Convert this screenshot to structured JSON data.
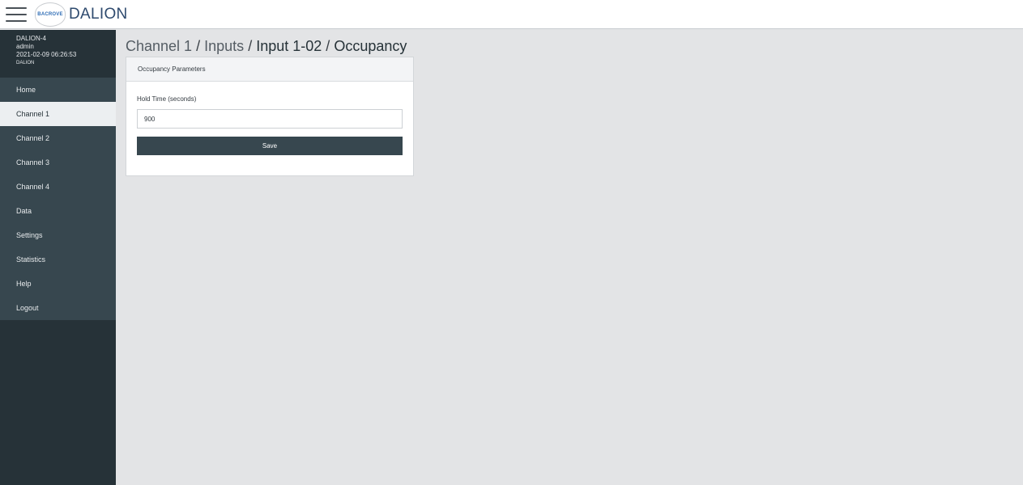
{
  "header": {
    "logo_text": "BACROVE",
    "app_title": "DALION"
  },
  "user": {
    "device_name": "DALION-4",
    "username": "admin",
    "datetime": "2021-02-09 06:26:53",
    "product": "DALION"
  },
  "sidebar": {
    "items": [
      {
        "label": "Home",
        "active": false
      },
      {
        "label": "Channel 1",
        "active": true
      },
      {
        "label": "Channel 2",
        "active": false
      },
      {
        "label": "Channel 3",
        "active": false
      },
      {
        "label": "Channel 4",
        "active": false
      },
      {
        "label": "Data",
        "active": false
      },
      {
        "label": "Settings",
        "active": false
      },
      {
        "label": "Statistics",
        "active": false
      },
      {
        "label": "Help",
        "active": false
      },
      {
        "label": "Logout",
        "active": false
      }
    ]
  },
  "breadcrumb": {
    "items": [
      "Channel 1",
      "Inputs",
      "Input 1-02",
      "Occupancy"
    ],
    "separator": "/"
  },
  "card": {
    "title": "Occupancy Parameters",
    "hold_time_label": "Hold Time (seconds)",
    "hold_time_value": "900",
    "save_label": "Save"
  },
  "colors": {
    "sidebar_dark": "#263238",
    "sidebar_nav": "#37474f",
    "active_item_bg": "#eceff1",
    "page_bg": "#e3e4e6",
    "save_button": "#37474f",
    "brand": "#2e4a6e"
  },
  "icons": {
    "menu": "hamburger-menu-icon",
    "logo": "bacrove-logo"
  }
}
